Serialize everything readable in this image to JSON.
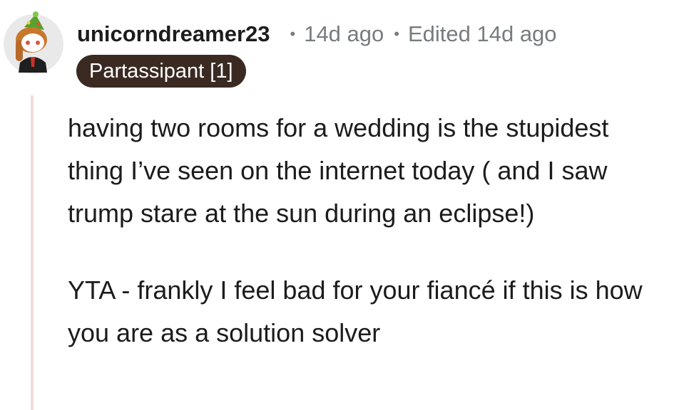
{
  "comment": {
    "username": "unicorndreamer23",
    "separator": "•",
    "age": "14d ago",
    "edited": "Edited 14d ago",
    "flair": "Partassipant [1]",
    "paragraphs": [
      "having two rooms for a wedding is the stupidest thing I’ve seen on the internet today ( and I saw trump stare at the sun during an eclipse!)",
      "YTA - frankly I feel bad for your fiancé if this is how you are as a solution solver"
    ]
  },
  "colors": {
    "flair_bg": "#3a2a22",
    "meta_text": "#787c7e",
    "thread_line": "#ecdcd8"
  },
  "icons": {
    "avatar": "snoo-avatar"
  }
}
